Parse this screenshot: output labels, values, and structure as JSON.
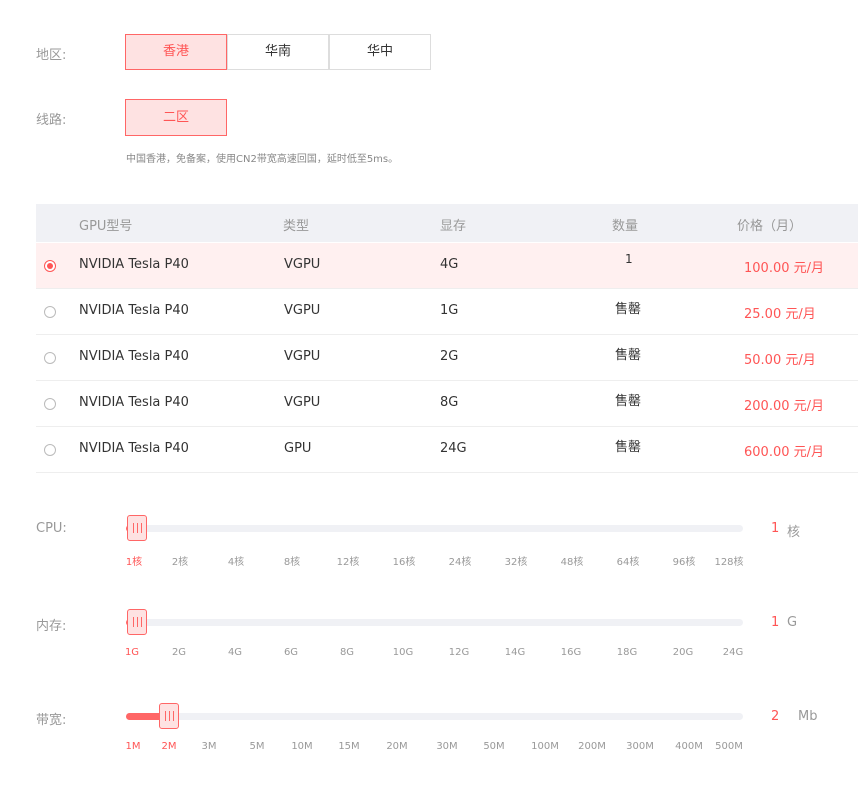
{
  "region": {
    "label": "地区:",
    "options": [
      "香港",
      "华南",
      "华中"
    ],
    "selected": "香港"
  },
  "line": {
    "label": "线路:",
    "options": [
      "二区"
    ],
    "selected": "二区",
    "note": "中国香港，免备案，使用CN2带宽高速回国，延时低至5ms。"
  },
  "table": {
    "headers": [
      "GPU型号",
      "类型",
      "显存",
      "数量",
      "价格（月）"
    ],
    "rows": [
      {
        "model": "NVIDIA Tesla P40",
        "type": "VGPU",
        "mem": "4G",
        "qty": "1",
        "price": "100.00 元/月",
        "selected": true
      },
      {
        "model": "NVIDIA Tesla P40",
        "type": "VGPU",
        "mem": "1G",
        "qty": "售罄",
        "price": "25.00 元/月",
        "selected": false
      },
      {
        "model": "NVIDIA Tesla P40",
        "type": "VGPU",
        "mem": "2G",
        "qty": "售罄",
        "price": "50.00 元/月",
        "selected": false
      },
      {
        "model": "NVIDIA Tesla P40",
        "type": "VGPU",
        "mem": "8G",
        "qty": "售罄",
        "price": "200.00 元/月",
        "selected": false
      },
      {
        "model": "NVIDIA Tesla P40",
        "type": "GPU",
        "mem": "24G",
        "qty": "售罄",
        "price": "600.00 元/月",
        "selected": false
      }
    ]
  },
  "cpu": {
    "label": "CPU:",
    "ticks": [
      "1核",
      "2核",
      "4核",
      "8核",
      "12核",
      "16核",
      "24核",
      "32核",
      "48核",
      "64核",
      "96核",
      "128核"
    ],
    "selected_index": 0,
    "value": "1",
    "unit": "核"
  },
  "memory": {
    "label": "内存:",
    "ticks": [
      "1G",
      "2G",
      "4G",
      "6G",
      "8G",
      "10G",
      "12G",
      "14G",
      "16G",
      "18G",
      "20G",
      "24G"
    ],
    "selected_index": 0,
    "value": "1",
    "unit": "G"
  },
  "bandwidth": {
    "label": "带宽:",
    "ticks": [
      "1M",
      "2M",
      "3M",
      "5M",
      "10M",
      "15M",
      "20M",
      "30M",
      "50M",
      "100M",
      "200M",
      "300M",
      "400M",
      "500M"
    ],
    "selected_index": 1,
    "value": "2",
    "unit": "Mb"
  },
  "colors": {
    "accent": "#ff5555",
    "accent_bg": "#fee2e2",
    "header_bg": "#f0f1f5"
  }
}
